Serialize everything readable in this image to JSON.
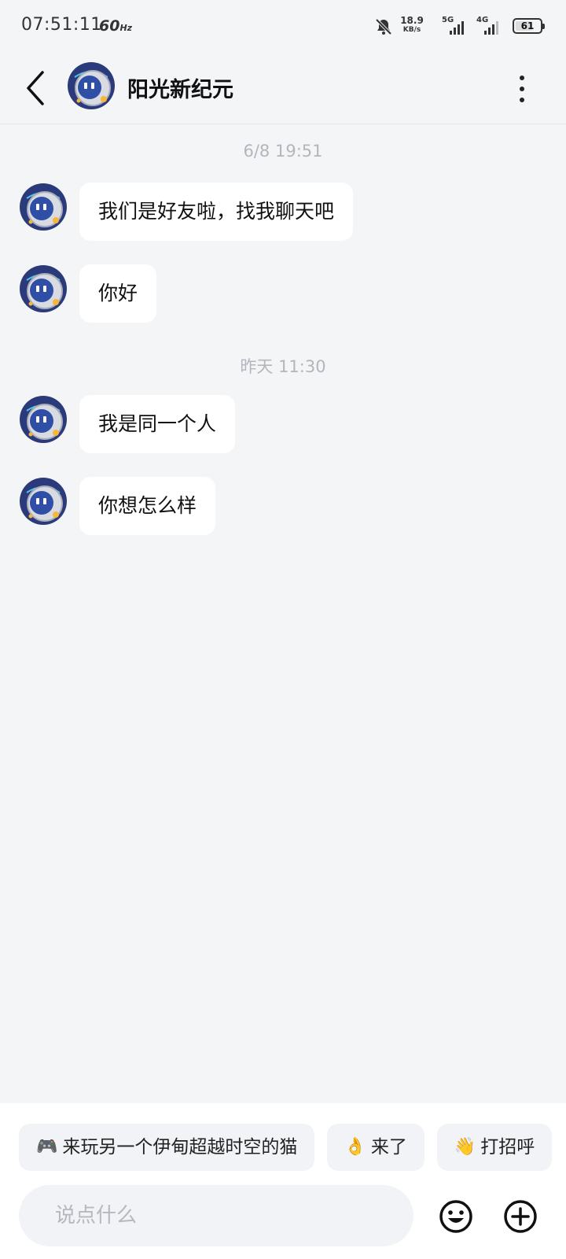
{
  "status_bar": {
    "time": "07:51:11",
    "refresh_rate": "60",
    "refresh_unit": "Hz",
    "net_speed": "18.9",
    "net_unit": "KB/s",
    "signal_1": "5G",
    "signal_2": "4G",
    "battery": "61"
  },
  "header": {
    "title": "阳光新纪元",
    "back_icon": "chevron-left-icon",
    "more_icon": "more-vertical-icon"
  },
  "chat": {
    "groups": [
      {
        "timestamp": "6/8  19:51",
        "messages": [
          "我们是好友啦，找我聊天吧",
          "你好"
        ]
      },
      {
        "timestamp": "昨天  11:30",
        "messages": [
          "我是同一个人",
          "你想怎么样"
        ]
      }
    ]
  },
  "quick_replies": [
    {
      "emoji": "🎮",
      "label": "来玩另一个伊甸超越时空的猫"
    },
    {
      "emoji": "👌",
      "label": "来了"
    },
    {
      "emoji": "👋",
      "label": "打招呼"
    }
  ],
  "composer": {
    "placeholder": "说点什么",
    "emoji_icon": "smiley-icon",
    "plus_icon": "plus-circle-icon"
  },
  "colors": {
    "background": "#f4f5f7",
    "bubble": "#ffffff",
    "avatar_primary": "#2f4ea6",
    "avatar_accent": "#f5b63a"
  }
}
